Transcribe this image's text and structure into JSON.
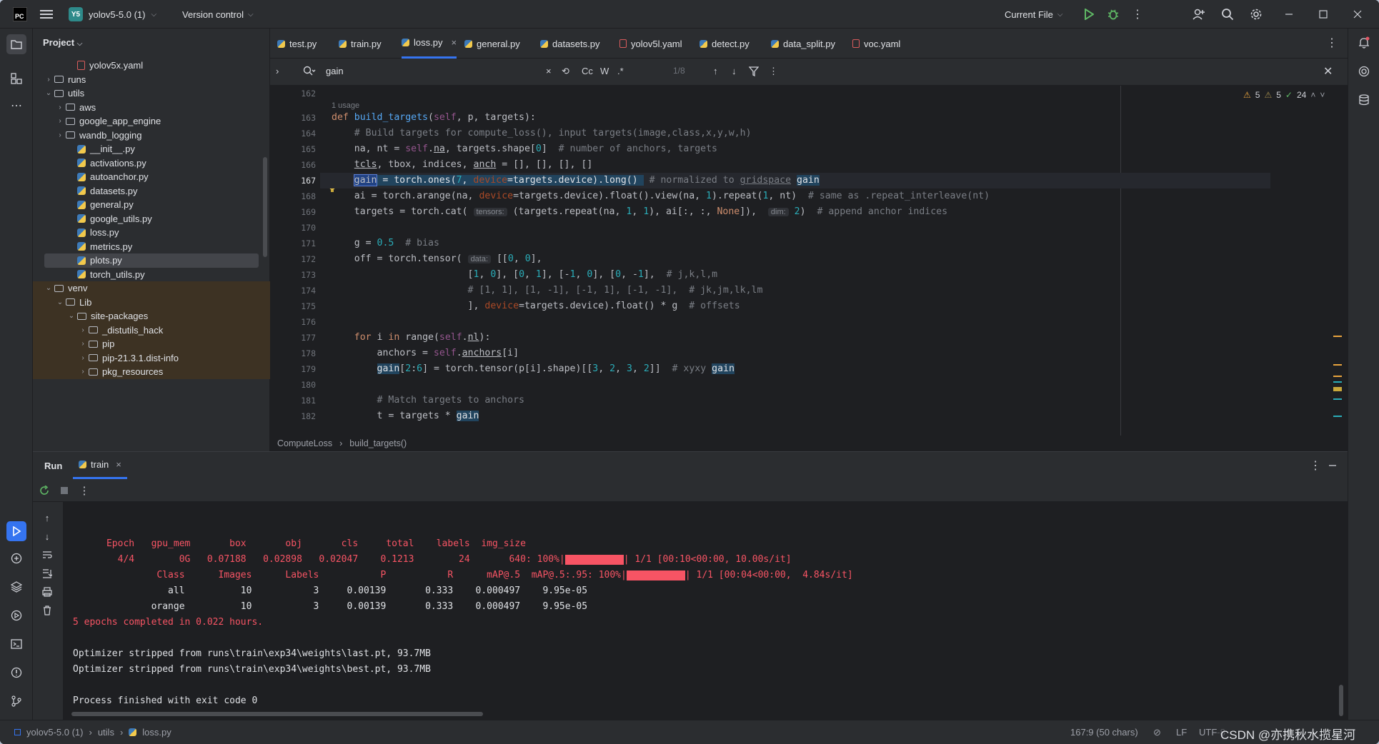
{
  "titlebar": {
    "app_badge": "PC",
    "project_badge": "Y5",
    "project_name": "yolov5-5.0 (1)",
    "vcs": "Version control",
    "run_config": "Current File"
  },
  "project_panel": {
    "title": "Project",
    "items": [
      {
        "label": "yolov5x.yaml",
        "icon": "yaml-icon",
        "indent": 3,
        "chev": ""
      },
      {
        "label": "runs",
        "icon": "folder-icon",
        "indent": 1,
        "chev": ">"
      },
      {
        "label": "utils",
        "icon": "folder-icon",
        "indent": 1,
        "chev": "v"
      },
      {
        "label": "aws",
        "icon": "folder-icon",
        "indent": 2,
        "chev": ">"
      },
      {
        "label": "google_app_engine",
        "icon": "folder-icon",
        "indent": 2,
        "chev": ">"
      },
      {
        "label": "wandb_logging",
        "icon": "folder-icon",
        "indent": 2,
        "chev": ">"
      },
      {
        "label": "__init__.py",
        "icon": "python-icon",
        "indent": 3,
        "chev": ""
      },
      {
        "label": "activations.py",
        "icon": "python-icon",
        "indent": 3,
        "chev": ""
      },
      {
        "label": "autoanchor.py",
        "icon": "python-icon",
        "indent": 3,
        "chev": ""
      },
      {
        "label": "datasets.py",
        "icon": "python-icon",
        "indent": 3,
        "chev": ""
      },
      {
        "label": "general.py",
        "icon": "python-icon",
        "indent": 3,
        "chev": ""
      },
      {
        "label": "google_utils.py",
        "icon": "python-icon",
        "indent": 3,
        "chev": ""
      },
      {
        "label": "loss.py",
        "icon": "python-icon",
        "indent": 3,
        "chev": ""
      },
      {
        "label": "metrics.py",
        "icon": "python-icon",
        "indent": 3,
        "chev": ""
      },
      {
        "label": "plots.py",
        "icon": "python-icon",
        "indent": 3,
        "chev": "",
        "selected": true
      },
      {
        "label": "torch_utils.py",
        "icon": "python-icon",
        "indent": 3,
        "chev": ""
      },
      {
        "label": "venv",
        "icon": "folder-icon",
        "indent": 1,
        "chev": "v",
        "venv": true
      },
      {
        "label": "Lib",
        "icon": "folder-icon",
        "indent": 2,
        "chev": "v",
        "venv": true
      },
      {
        "label": "site-packages",
        "icon": "folder-icon",
        "indent": 3,
        "chev": "v",
        "venv": true
      },
      {
        "label": "_distutils_hack",
        "icon": "folder-icon",
        "indent": 4,
        "chev": ">",
        "venv": true
      },
      {
        "label": "pip",
        "icon": "folder-icon",
        "indent": 4,
        "chev": ">",
        "venv": true
      },
      {
        "label": "pip-21.3.1.dist-info",
        "icon": "folder-icon",
        "indent": 4,
        "chev": ">",
        "venv": true
      },
      {
        "label": "pkg_resources",
        "icon": "folder-icon",
        "indent": 4,
        "chev": ">",
        "venv": true
      }
    ]
  },
  "tabs": [
    {
      "label": "test.py",
      "icon": "python-icon"
    },
    {
      "label": "train.py",
      "icon": "python-icon"
    },
    {
      "label": "loss.py",
      "icon": "python-icon",
      "active": true
    },
    {
      "label": "general.py",
      "icon": "python-icon"
    },
    {
      "label": "datasets.py",
      "icon": "python-icon"
    },
    {
      "label": "yolov5l.yaml",
      "icon": "yaml-icon"
    },
    {
      "label": "detect.py",
      "icon": "python-icon"
    },
    {
      "label": "data_split.py",
      "icon": "python-icon"
    },
    {
      "label": "voc.yaml",
      "icon": "yaml-icon"
    }
  ],
  "find": {
    "query": "gain",
    "match_case": "Cc",
    "words": "W",
    "regex": ".*",
    "count": "1/8"
  },
  "inspections": {
    "warnings_a": "5",
    "warnings_b": "5",
    "ok": "24"
  },
  "editor": {
    "usage_hint": "1 usage",
    "line_numbers": [
      "162",
      "",
      "163",
      "164",
      "165",
      "166",
      "167",
      "168",
      "169",
      "170",
      "171",
      "172",
      "173",
      "174",
      "175",
      "176",
      "177",
      "178",
      "179",
      "180",
      "181",
      "182"
    ],
    "hint_tensors": "tensors:",
    "hint_dim": "dim:",
    "hint_data": "data:"
  },
  "breadcrumbs": {
    "class": "ComputeLoss",
    "method": "build_targets()"
  },
  "run": {
    "title": "Run",
    "tab": "train",
    "console": {
      "header": "      Epoch   gpu_mem       box       obj       cls     total    labels  img_size",
      "epoch_row_a": "        4/4        0G   0.07188   0.02898   0.02047    0.1213        24       640: 100%|",
      "epoch_row_b": "| 1/1 [00:10<00:00, 10.00s/it]",
      "class_row_a": "               Class      Images      Labels           P           R      mAP@.5  mAP@.5:.95: 100%|",
      "class_row_b": "| 1/1 [00:04<00:00,  4.84s/it]",
      "all_row": "                 all          10           3     0.00139       0.333    0.000497    9.95e-05",
      "orange_row": "              orange          10           3     0.00139       0.333    0.000497    9.95e-05",
      "epochs_done": "5 epochs completed in 0.022 hours.",
      "strip_last": "Optimizer stripped from runs\\train\\exp34\\weights\\last.pt, 93.7MB",
      "strip_best": "Optimizer stripped from runs\\train\\exp34\\weights\\best.pt, 93.7MB",
      "exit": "Process finished with exit code 0"
    }
  },
  "status": {
    "project": "yolov5-5.0 (1)",
    "folder": "utils",
    "file": "loss.py",
    "position": "167:9 (50 chars)",
    "line_sep": "LF",
    "encoding": "UTF-8",
    "watermark": "CSDN @亦携秋水揽星河"
  }
}
